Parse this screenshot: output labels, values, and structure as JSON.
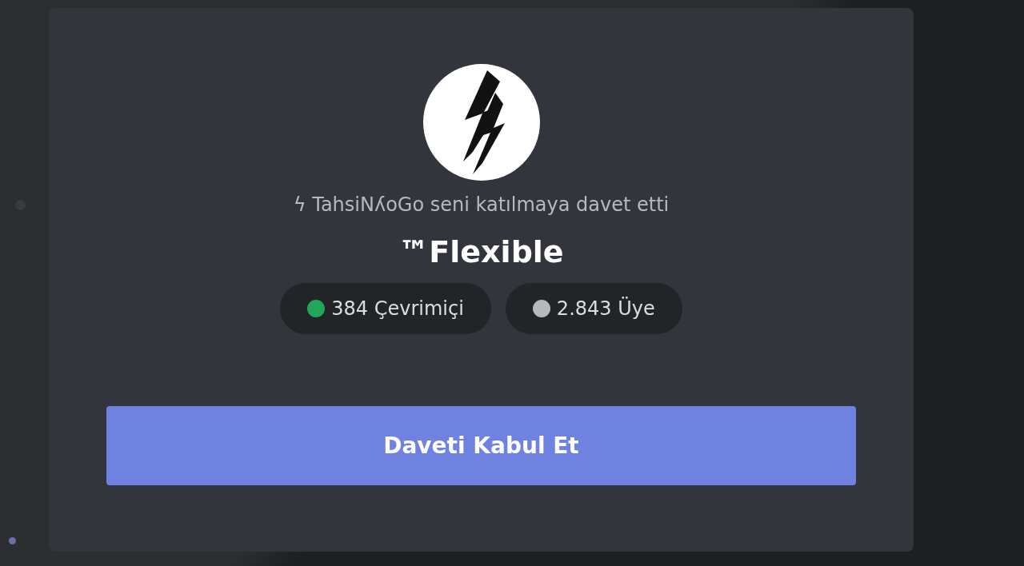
{
  "invite": {
    "inviter": "ϟ TahsiNʎoGo seni katılmaya davet etti",
    "server_name": "™Flexible",
    "stats": [
      {
        "text": "384 Çevrimiçi",
        "color": "#23a55a"
      },
      {
        "text": "2.843 Üye",
        "color": "#b5b8bd"
      }
    ],
    "accept_button": "Daveti Kabul Et"
  }
}
